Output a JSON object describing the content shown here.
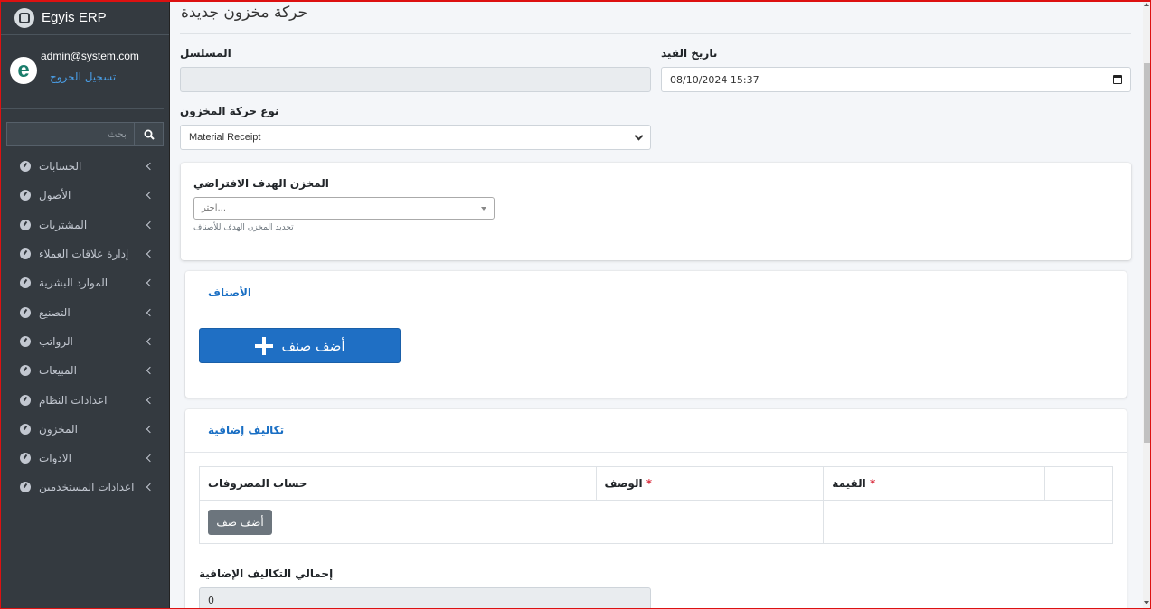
{
  "brand": {
    "name": "Egyis ERP"
  },
  "user": {
    "email": "admin@system.com",
    "logout": "تسجيل الخروج",
    "avatar_letter": "e"
  },
  "search": {
    "placeholder": "بحث"
  },
  "nav": [
    {
      "label": "الحسابات",
      "icon": "dashboard-icon"
    },
    {
      "label": "الأصول",
      "icon": "dashboard-icon"
    },
    {
      "label": "المشتريات",
      "icon": "dashboard-icon"
    },
    {
      "label": "إدارة علاقات العملاء",
      "icon": "dashboard-icon"
    },
    {
      "label": "الموارد البشرية",
      "icon": "dashboard-icon"
    },
    {
      "label": "التصنيع",
      "icon": "dashboard-icon"
    },
    {
      "label": "الرواتب",
      "icon": "dashboard-icon"
    },
    {
      "label": "المبيعات",
      "icon": "dashboard-icon"
    },
    {
      "label": "اعدادات النظام",
      "icon": "dashboard-icon"
    },
    {
      "label": "المخزون",
      "icon": "dashboard-icon"
    },
    {
      "label": "الادوات",
      "icon": "dashboard-icon"
    },
    {
      "label": "اعدادات المستخدمين",
      "icon": "dashboard-icon"
    }
  ],
  "page": {
    "title": "حركة مخزون جديدة"
  },
  "form": {
    "posting_date_label": "تاريخ القيد",
    "posting_date_value": "08/10/2024 15:37",
    "serial_label": "المسلسل",
    "serial_value": "",
    "entry_type_label": "نوع حركة المخزون",
    "entry_type_value": "Material Receipt",
    "default_target_label": "المخزن الهدف الافتراضي",
    "default_target_placeholder": "اختر...",
    "default_target_help": "تحديد المخزن الهدف للأصناف"
  },
  "items_card": {
    "title": "الأصناف",
    "add_button": "أضف صنف"
  },
  "costs_card": {
    "title": "تكاليف إضافية",
    "columns": [
      "حساب المصروفات",
      "الوصف",
      "القيمة"
    ],
    "add_row": "أضف صف",
    "total_label": "إجمالي التكاليف الإضافية",
    "total_value": "0"
  },
  "colors": {
    "sidebar": "#343a40",
    "primary": "#1f6fc4",
    "link": "#4a9fe8",
    "required": "#dc3545"
  }
}
